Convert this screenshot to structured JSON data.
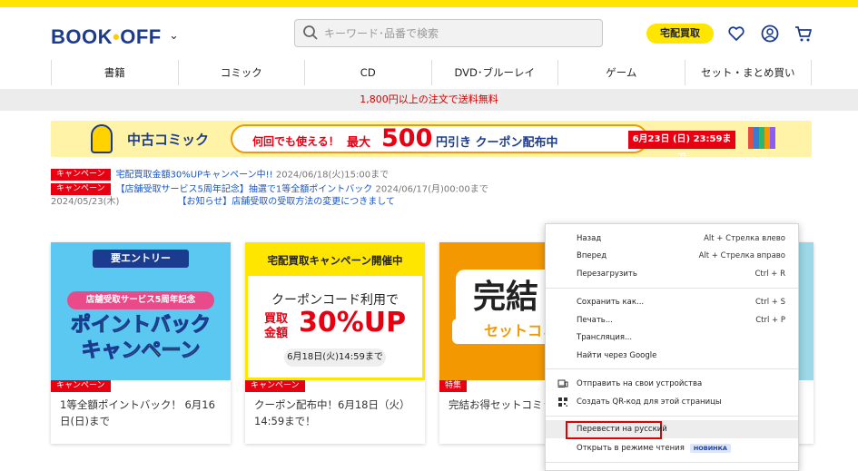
{
  "header": {
    "logo_text_a": "BOOK",
    "logo_dot": "•",
    "logo_text_b": "OFF",
    "logo_chevron": "⌄",
    "search_placeholder": "キーワード･品番で検索",
    "takuhai_label": "宅配買取",
    "icons": [
      "heart-icon",
      "account-icon",
      "cart-icon"
    ]
  },
  "nav": [
    "書籍",
    "コミック",
    "CD",
    "DVD･ブルーレイ",
    "ゲーム",
    "セット・まとめ買い"
  ],
  "shipping_notice": "1,800円以上の注文で送料無料",
  "banner": {
    "category": "中古コミック",
    "lead": "何回でも使える！",
    "max": "最大",
    "amount": "500",
    "tail": "円引き クーポン配布中",
    "deadline": "6月23日 (日) 23:59まで"
  },
  "news": [
    {
      "tag": "キャンペーン",
      "text": "宅配買取金額30%UPキャンペーン中!!",
      "date": "2024/06/18(火)15:00まで"
    },
    {
      "tag": "キャンペーン",
      "text": "【店舗受取サービス5周年記念】抽選で1等全額ポイントバック",
      "date": "2024/06/17(月)00:00まで"
    },
    {
      "date": "2024/05/23(木)",
      "text": "【お知らせ】店舗受取の受取方法の変更につきまして"
    }
  ],
  "cards": [
    {
      "badge": "キャンペーン",
      "title": "1等全額ポイントバック！ 6月16日(日)まで",
      "img_top": "要エントリー",
      "img_ribbon": "店舗受取サービス5周年記念",
      "img_big1": "ポイントバック",
      "img_big2": "キャンペーン"
    },
    {
      "badge": "キャンペーン",
      "title": "クーポン配布中！6月18日（火）14:59まで！",
      "img_head": "宅配買取キャンペーン開催中",
      "img_l1": "クーポンコード利用で",
      "img_l2": "買取 金額",
      "img_l3": "30%UP",
      "img_l4": "6月18日(火)14:59まで"
    },
    {
      "badge": "特集",
      "title": "完結お得セットコミック",
      "img_k1": "完結",
      "img_k2": "セットコミ"
    }
  ],
  "context_menu": [
    {
      "label": "Назад",
      "shortcut": "Alt + Стрелка влево"
    },
    {
      "label": "Вперед",
      "shortcut": "Alt + Стрелка вправо"
    },
    {
      "label": "Перезагрузить",
      "shortcut": "Ctrl + R"
    },
    {
      "label": "Сохранить как...",
      "shortcut": "Ctrl + S"
    },
    {
      "label": "Печать...",
      "shortcut": "Ctrl + P"
    },
    {
      "label": "Трансляция..."
    },
    {
      "label": "Найти через Google"
    },
    {
      "label": "Отправить на свои устройства",
      "icon": "send-to-devices-icon"
    },
    {
      "label": "Создать QR-код для этой страницы",
      "icon": "qr-code-icon"
    },
    {
      "label": "Перевести на русский"
    },
    {
      "label": "Открыть в режиме чтения",
      "badge": "НОВИНКА"
    }
  ]
}
